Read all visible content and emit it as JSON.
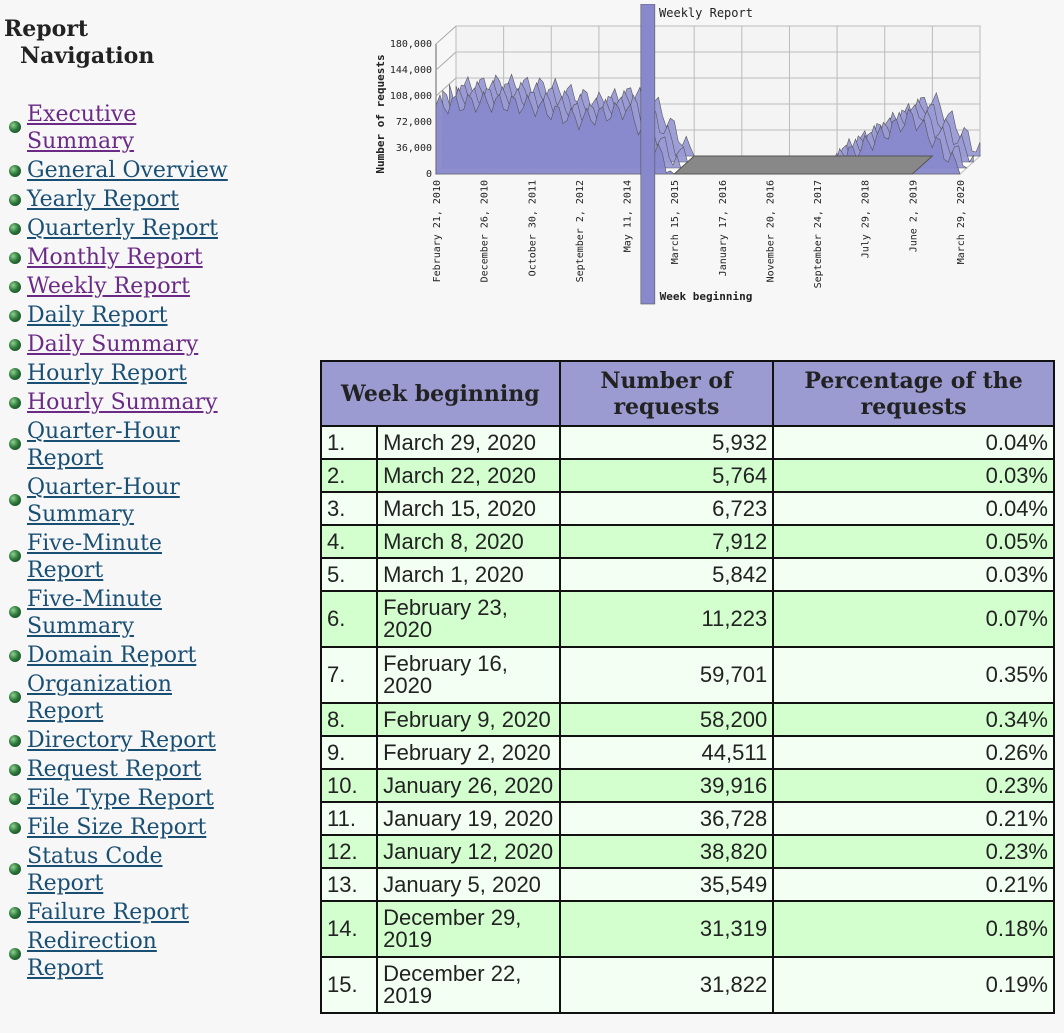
{
  "nav": {
    "title_line1": "Report",
    "title_line2": "Navigation",
    "items": [
      {
        "label": "Executive Summary",
        "visited": true
      },
      {
        "label": "General Overview",
        "visited": false
      },
      {
        "label": "Yearly Report",
        "visited": false
      },
      {
        "label": "Quarterly Report",
        "visited": false
      },
      {
        "label": "Monthly Report",
        "visited": true
      },
      {
        "label": "Weekly Report",
        "visited": true
      },
      {
        "label": "Daily Report",
        "visited": false
      },
      {
        "label": "Daily Summary",
        "visited": true
      },
      {
        "label": "Hourly Report",
        "visited": false
      },
      {
        "label": "Hourly Summary",
        "visited": true
      },
      {
        "label": "Quarter-Hour Report",
        "visited": false
      },
      {
        "label": "Quarter-Hour Summary",
        "visited": false
      },
      {
        "label": "Five-Minute Report",
        "visited": false
      },
      {
        "label": "Five-Minute Summary",
        "visited": false
      },
      {
        "label": "Domain Report",
        "visited": false
      },
      {
        "label": "Organization Report",
        "visited": false
      },
      {
        "label": "Directory Report",
        "visited": false
      },
      {
        "label": "Request Report",
        "visited": false
      },
      {
        "label": "File Type Report",
        "visited": false
      },
      {
        "label": "File Size Report",
        "visited": false
      },
      {
        "label": "Status Code Report",
        "visited": false
      },
      {
        "label": "Failure Report",
        "visited": false
      },
      {
        "label": "Redirection Report",
        "visited": false
      }
    ],
    "colors": {
      "link": "#1a4f74",
      "visited": "#6b2a86"
    }
  },
  "chart_data": {
    "type": "area",
    "title": "Weekly Report",
    "xlabel": "Week beginning",
    "ylabel": "Number of requests",
    "yticks": [
      "0",
      "36,000",
      "72,000",
      "108,000",
      "144,000",
      "180,000"
    ],
    "ylim": [
      0,
      180000
    ],
    "xticks": [
      "February 21, 2010",
      "December 26, 2010",
      "October 30, 2011",
      "September 2, 2012",
      "May 11, 2014",
      "March 15, 2015",
      "January 17, 2016",
      "November 20, 2016",
      "September 24, 2017",
      "July 29, 2018",
      "June 2, 2019",
      "March 29, 2020"
    ],
    "grid": true,
    "series_color": "#8888cc",
    "approx_profile": [
      {
        "x": "February 21, 2010",
        "y": 95000
      },
      {
        "x": "December 26, 2010",
        "y": 100000
      },
      {
        "x": "October 30, 2011",
        "y": 95000
      },
      {
        "x": "September 2, 2012",
        "y": 75000
      },
      {
        "x": "May 11, 2014",
        "y": 90000
      },
      {
        "x": "March 15, 2015",
        "y": 0
      },
      {
        "x": "September 24, 2017",
        "y": 0
      },
      {
        "x": "June 2, 2019",
        "y": 80000
      },
      {
        "x": "March 29, 2020",
        "y": 5932
      }
    ]
  },
  "table": {
    "headers": [
      "Week beginning",
      "Number of requests",
      "Percentage of the requests"
    ],
    "header_bg": "#9b9bd2",
    "rows": [
      {
        "rank": "1.",
        "week": "March 29, 2020",
        "requests": "5,932",
        "pct": "0.04%"
      },
      {
        "rank": "2.",
        "week": "March 22, 2020",
        "requests": "5,764",
        "pct": "0.03%"
      },
      {
        "rank": "3.",
        "week": "March 15, 2020",
        "requests": "6,723",
        "pct": "0.04%"
      },
      {
        "rank": "4.",
        "week": "March 8, 2020",
        "requests": "7,912",
        "pct": "0.05%"
      },
      {
        "rank": "5.",
        "week": "March 1, 2020",
        "requests": "5,842",
        "pct": "0.03%"
      },
      {
        "rank": "6.",
        "week": "February 23, 2020",
        "requests": "11,223",
        "pct": "0.07%"
      },
      {
        "rank": "7.",
        "week": "February 16, 2020",
        "requests": "59,701",
        "pct": "0.35%"
      },
      {
        "rank": "8.",
        "week": "February 9, 2020",
        "requests": "58,200",
        "pct": "0.34%"
      },
      {
        "rank": "9.",
        "week": "February 2, 2020",
        "requests": "44,511",
        "pct": "0.26%"
      },
      {
        "rank": "10.",
        "week": "January 26, 2020",
        "requests": "39,916",
        "pct": "0.23%"
      },
      {
        "rank": "11.",
        "week": "January 19, 2020",
        "requests": "36,728",
        "pct": "0.21%"
      },
      {
        "rank": "12.",
        "week": "January 12, 2020",
        "requests": "38,820",
        "pct": "0.23%"
      },
      {
        "rank": "13.",
        "week": "January 5, 2020",
        "requests": "35,549",
        "pct": "0.21%"
      },
      {
        "rank": "14.",
        "week": "December 29, 2019",
        "requests": "31,319",
        "pct": "0.18%"
      },
      {
        "rank": "15.",
        "week": "December 22, 2019",
        "requests": "31,822",
        "pct": "0.19%"
      }
    ]
  }
}
